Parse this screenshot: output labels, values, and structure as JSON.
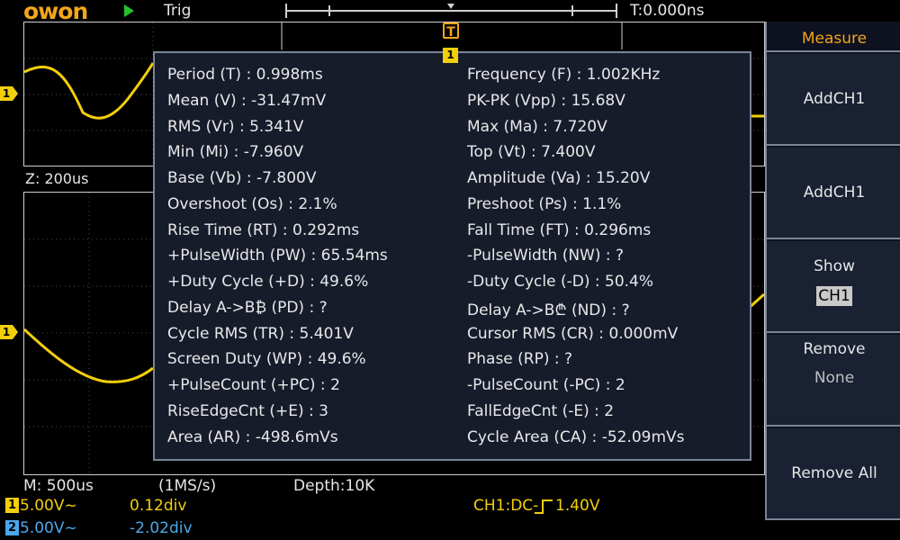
{
  "header": {
    "logo": "owon",
    "trig_label": "Trig",
    "time_position": "T:0.000ns"
  },
  "zoom_label": "Z: 200us",
  "trigger_marker": "T",
  "channels": {
    "ch1_marker": "1",
    "ch1_marker_lower": "1"
  },
  "measure": {
    "channel_tag": "1",
    "left": [
      "Period (T) : 0.998ms",
      "Mean (V) : -31.47mV",
      "RMS (Vr) : 5.341V",
      "Min (Mi) : -7.960V",
      "Base (Vb) : -7.800V",
      "Overshoot (Os) : 2.1%",
      "Rise Time (RT) : 0.292ms",
      "+PulseWidth (PW) : 65.54ms",
      "+Duty Cycle (+D) : 49.6%",
      "Delay A->B₿ (PD) :   ?",
      "Cycle RMS (TR) : 5.401V",
      "Screen Duty (WP) : 49.6%",
      "+PulseCount (+PC) : 2",
      "RiseEdgeCnt (+E) : 3",
      "Area (AR) : -498.6mVs"
    ],
    "right": [
      "Frequency (F) : 1.002KHz",
      "PK-PK (Vpp) : 15.68V",
      "Max (Ma) : 7.720V",
      "Top (Vt) : 7.400V",
      "Amplitude (Va) : 15.20V",
      "Preshoot (Ps) : 1.1%",
      "Fall Time (FT) : 0.296ms",
      "-PulseWidth (NW) :   ?",
      "-Duty Cycle (-D) : 50.4%",
      "Delay A->B₾ (ND) :   ?",
      "Cursor RMS (CR) : 0.000mV",
      "Phase (RP) :   ?",
      "-PulseCount (-PC) : 2",
      "FallEdgeCnt (-E) : 2",
      "Cycle Area (CA) : -52.09mVs"
    ]
  },
  "menu": {
    "title": "Measure",
    "add_ch1_a": "AddCH1",
    "add_ch1_b": "AddCH1",
    "show_label": "Show",
    "show_value": "CH1",
    "remove_label": "Remove",
    "remove_value": "None",
    "remove_all": "Remove All"
  },
  "status": {
    "timebase": "M: 500us",
    "sample_rate": "(1MS/s)",
    "depth": "Depth:10K",
    "ch1_badge": "1",
    "ch1_volts": "5.00V~",
    "ch1_offset": "0.12div",
    "ch2_badge": "2",
    "ch2_volts": "5.00V~",
    "ch2_offset": "-2.02div",
    "trigger_info": "CH1:DC-",
    "trigger_level": "1.40V"
  },
  "colors": {
    "ch1": "#f2cf0b",
    "ch2": "#4aa8ea",
    "accent": "#f3a51a",
    "run": "#22c42a"
  }
}
